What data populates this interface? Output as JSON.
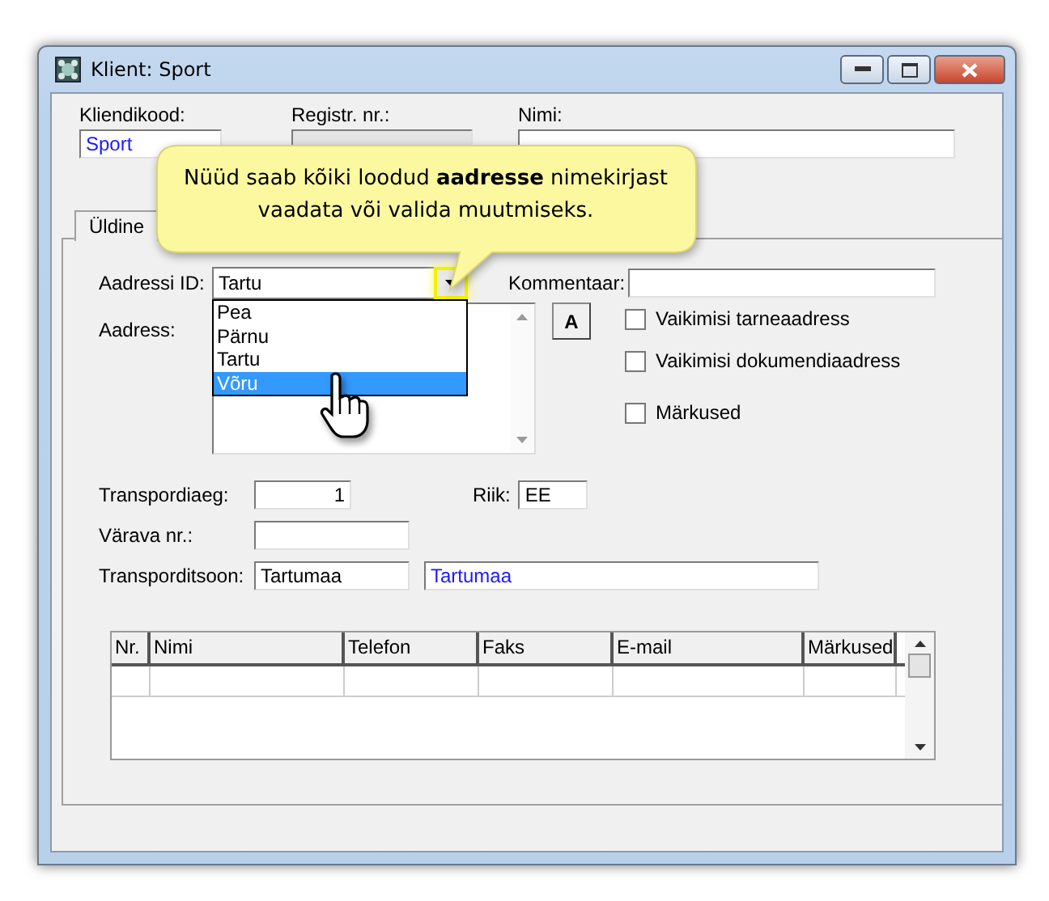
{
  "window": {
    "title": "Klient: Sport"
  },
  "header_fields": [
    {
      "label": "Kliendikood:",
      "value": "Sport",
      "disabled": false
    },
    {
      "label": "Registr. nr.:",
      "disabled": true
    },
    {
      "label": "Nimi:",
      "disabled": false
    }
  ],
  "tabs": [
    {
      "label": "Üldine",
      "selected": true
    }
  ],
  "address_id": {
    "label": "Aadressi ID:",
    "value": "Tartu",
    "expanded": true,
    "options": [
      {
        "label": "Pea",
        "highlighted": false
      },
      {
        "label": "Pärnu",
        "highlighted": false
      },
      {
        "label": "Tartu",
        "highlighted": false
      },
      {
        "label": "Võru",
        "highlighted": true
      }
    ]
  },
  "comment": {
    "label": "Kommentaar:"
  },
  "address": {
    "label": "Aadress:"
  },
  "format_button": "A",
  "checkboxes": [
    {
      "label": "Vaikimisi tarneaadress",
      "checked": false
    },
    {
      "label": "Vaikimisi dokumendiaadress",
      "checked": false
    },
    {
      "label": "Märkused",
      "checked": false
    }
  ],
  "transport_time": {
    "label": "Transpordiaeg:",
    "value": "1"
  },
  "country": {
    "label": "Riik:",
    "value": "EE"
  },
  "gate": {
    "label": "Värava nr.:"
  },
  "transport_zone": {
    "label": "Transporditsoon:",
    "code": "Tartumaa",
    "name": "Tartumaa"
  },
  "contacts_table": {
    "columns": [
      "Nr.",
      "Nimi",
      "Telefon",
      "Faks",
      "E-mail",
      "Märkused"
    ]
  },
  "callout": {
    "text": "Nüüd saab kõiki loodud **aadresse** nimekirjast vaadata või valida muutmiseks."
  }
}
